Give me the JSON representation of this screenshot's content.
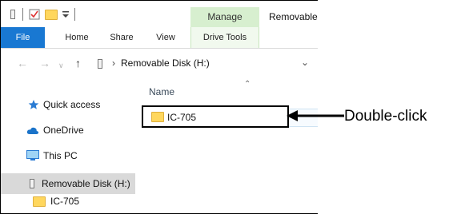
{
  "title_bar": {
    "context_tab": "Manage",
    "window_title": "Removable Disk (H:)"
  },
  "ribbon": {
    "tabs": [
      "File",
      "Home",
      "Share",
      "View",
      "Drive Tools"
    ],
    "accent": "#1978d2",
    "context_accent": "#d7efcf"
  },
  "address_bar": {
    "path_segment": "Removable Disk (H:)"
  },
  "navigation_pane": {
    "items": [
      {
        "label": "Quick access",
        "icon": "star-icon"
      },
      {
        "label": "OneDrive",
        "icon": "cloud-icon"
      },
      {
        "label": "This PC",
        "icon": "monitor-icon"
      },
      {
        "label": "Removable Disk (H:)",
        "icon": "usb-drive-icon",
        "selected": true
      },
      {
        "label": "IC-705",
        "icon": "folder-icon"
      }
    ]
  },
  "content": {
    "column_header": "Name",
    "files": [
      {
        "name": "IC-705",
        "type": "folder"
      }
    ]
  },
  "annotation": {
    "text": "Double-click"
  }
}
